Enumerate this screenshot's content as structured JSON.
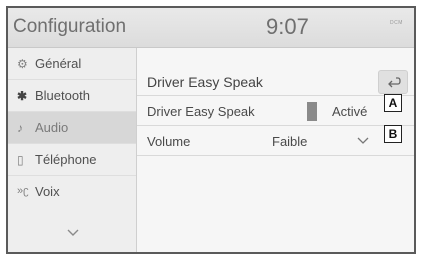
{
  "header": {
    "title": "Configuration",
    "clock": "9:07",
    "status_icon": "dcm-icon"
  },
  "sidebar": {
    "items": [
      {
        "label": "Général",
        "icon": "gear-icon"
      },
      {
        "label": "Bluetooth",
        "icon": "bluetooth-icon"
      },
      {
        "label": "Audio",
        "icon": "music-note-icon",
        "selected": true
      },
      {
        "label": "Téléphone",
        "icon": "phone-icon"
      },
      {
        "label": "Voix",
        "icon": "voice-icon"
      }
    ],
    "more_icon": "chevron-down-icon"
  },
  "content": {
    "heading": "Driver Easy Speak",
    "back_icon": "back-arrow-icon",
    "rows": [
      {
        "label": "Driver Easy Speak",
        "value": "Activé",
        "control": "toggle"
      },
      {
        "label": "Volume",
        "value": "Faible",
        "control": "dropdown"
      }
    ]
  },
  "callouts": [
    "A",
    "B"
  ]
}
